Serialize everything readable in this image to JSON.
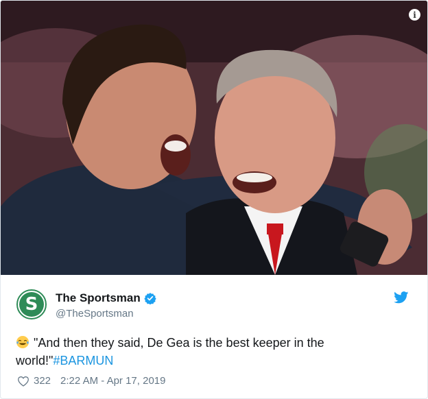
{
  "tweet": {
    "display_name": "The Sportsman",
    "handle": "@TheSportsman",
    "avatar_letter": "S",
    "verified": true,
    "text": "\"And then they said, De Gea is the best keeper in the world!\"",
    "hashtag": "#BARMUN",
    "emoji": "face-with-tears-of-joy",
    "likes": "322",
    "timestamp": "2:22 AM - Apr 17, 2019"
  },
  "media": {
    "info_label": "i",
    "description_icon": "info-icon"
  },
  "colors": {
    "brand": "#1da1f2",
    "hashtag": "#1b95e0",
    "secondary_text": "#657786",
    "avatar_green": "#2e8b57",
    "border": "#e1e8ed"
  }
}
